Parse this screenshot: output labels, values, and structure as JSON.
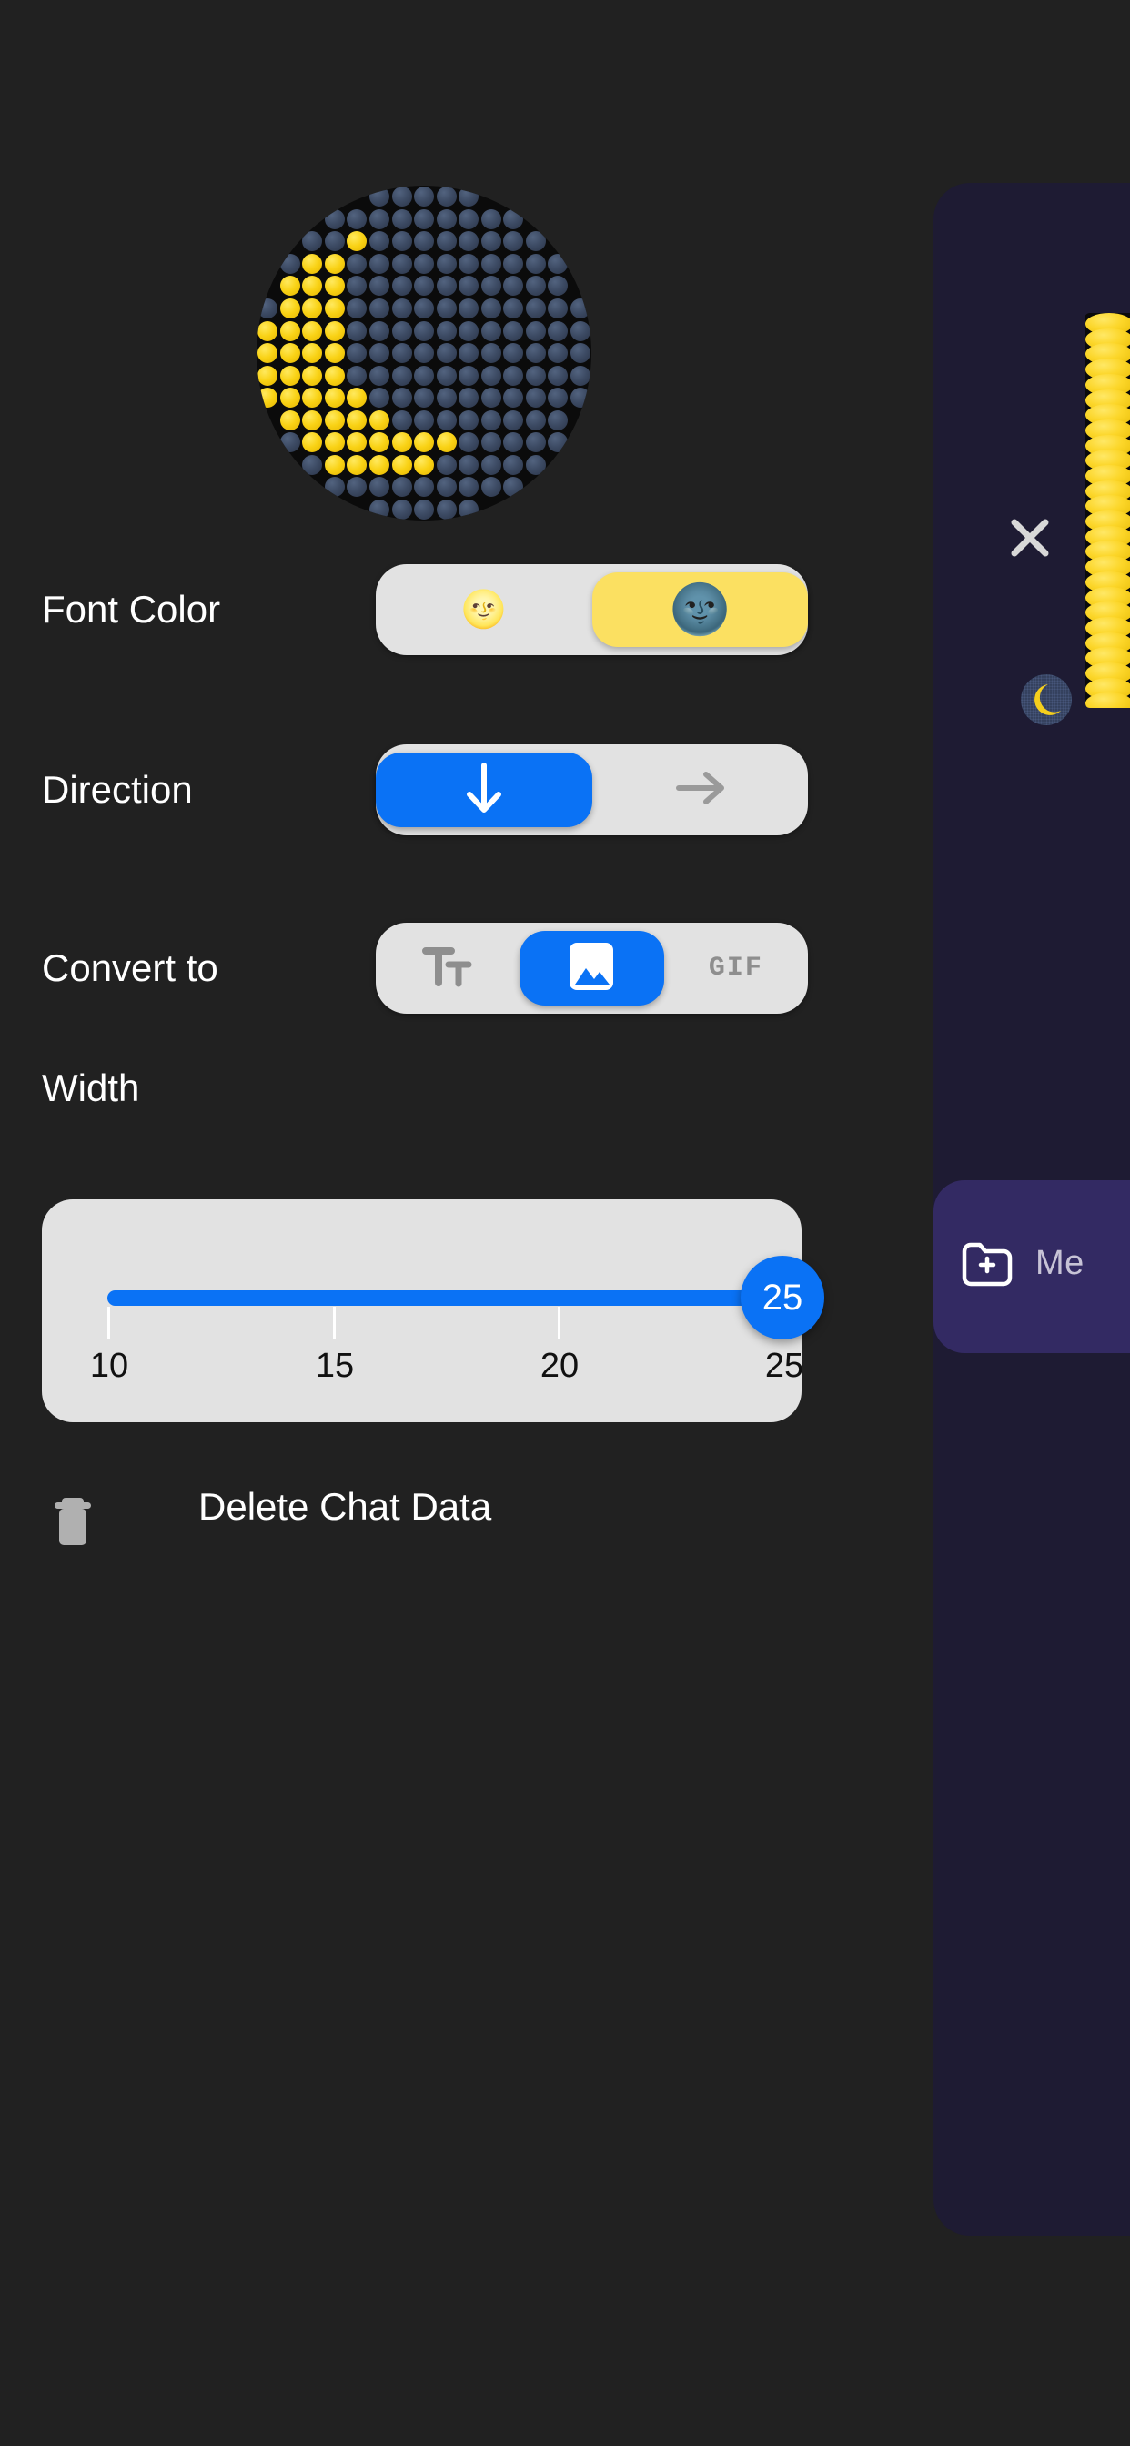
{
  "settings": {
    "rows": [
      {
        "label": "Font Color",
        "type": "segmented",
        "options": [
          {
            "name": "light-moon-face",
            "glyph": "🌝",
            "selected": false
          },
          {
            "name": "dark-moon-face",
            "glyph": "🌚",
            "selected": true
          }
        ]
      },
      {
        "label": "Direction",
        "type": "segmented",
        "options": [
          {
            "name": "arrow-down",
            "glyph": "",
            "selected": true
          },
          {
            "name": "arrow-right",
            "glyph": "",
            "selected": false
          }
        ]
      },
      {
        "label": "Convert to",
        "type": "segmented",
        "options": [
          {
            "name": "text-format",
            "glyph": "",
            "selected": false
          },
          {
            "name": "image",
            "glyph": "",
            "selected": true
          },
          {
            "name": "gif",
            "glyph": "GIF",
            "selected": false
          }
        ]
      }
    ],
    "width": {
      "label": "Width",
      "value": "25",
      "min": 10,
      "max": 25,
      "ticks": [
        "10",
        "15",
        "20",
        "25"
      ]
    },
    "delete": {
      "label": "Delete Chat Data",
      "icon": "trash-icon"
    }
  },
  "chat_panel": {
    "close_label": "×",
    "bottom_card_label": "Me"
  },
  "colors": {
    "background": "#212121",
    "accent_blue": "#0a72f5",
    "accent_yellow": "#fbe061",
    "control_track": "#e2e2e2",
    "panel_navy": "#1e1b33",
    "panel_purple": "#332a63",
    "dot_yellow": "#f9d215",
    "dot_navy": "#3c4a63"
  }
}
